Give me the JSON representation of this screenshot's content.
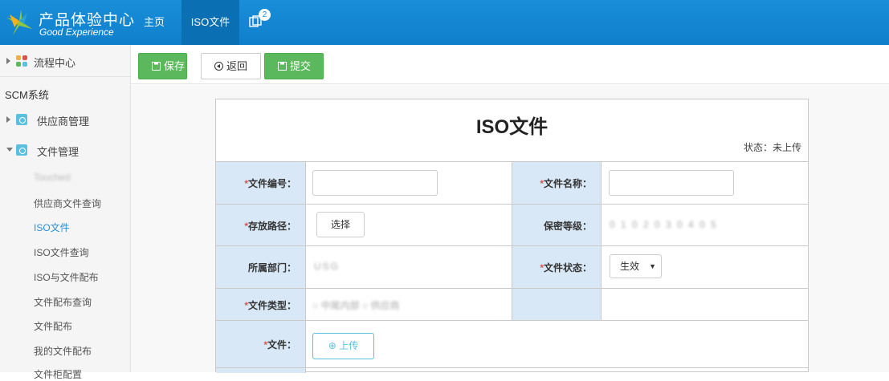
{
  "header": {
    "brand_cn": "产品体验中心",
    "brand_en": "Good Experience",
    "nav": {
      "home": "主页",
      "iso": "ISO文件"
    },
    "message_count": "2",
    "colors": {
      "bar": "#1a8ed8",
      "active_tab": "#0b6fb4"
    }
  },
  "sidebar": {
    "flow_center": "流程中心",
    "section_title": "SCM系统",
    "groups": [
      {
        "label": "供应商管理",
        "expanded": false
      },
      {
        "label": "文件管理",
        "expanded": true
      }
    ],
    "sub_items": [
      {
        "label": "Touched",
        "blurred": true
      },
      {
        "label": "供应商文件查询"
      },
      {
        "label": "ISO文件",
        "active": true
      },
      {
        "label": "ISO文件查询"
      },
      {
        "label": "ISO与文件配布"
      },
      {
        "label": "文件配布查询"
      },
      {
        "label": "文件配布"
      },
      {
        "label": "我的文件配布"
      },
      {
        "label": "文件柜配置"
      }
    ]
  },
  "toolbar": {
    "save": "保存",
    "back": "返回",
    "submit": "提交"
  },
  "form": {
    "title": "ISO文件",
    "status": "状态：未上传",
    "fields": {
      "file_no": "文件编号：",
      "file_name": "文件名称：",
      "storage_path": "存放路径：",
      "secrecy_level": "保密等级：",
      "department": "所属部门：",
      "file_status": "文件状态：",
      "file_type": "文件类型：",
      "file": "文件："
    },
    "choose_button": "选择",
    "secrecy_options_blurred": "0 1 0 2 0 3 0 4 0 5",
    "department_value_blurred": "USG",
    "status_select_value": "生效",
    "file_type_blurred": "○ 中尾内部  ○ 供应商",
    "upload_button": "上传"
  }
}
